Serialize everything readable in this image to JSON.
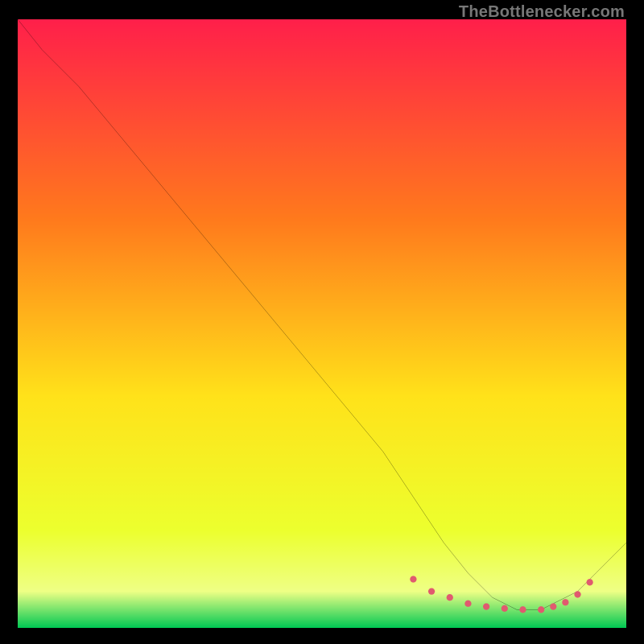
{
  "attribution": "TheBottlenecker.com",
  "chart_data": {
    "type": "line",
    "title": "",
    "xlabel": "",
    "ylabel": "",
    "xlim": [
      0,
      100
    ],
    "ylim": [
      0,
      100
    ],
    "background_gradient": {
      "top_color": "#ff1f4a",
      "upper_mid_color": "#ff7a1c",
      "mid_color": "#ffe21a",
      "lower_mid_color": "#ecff2e",
      "band_color": "#eeff85",
      "bottom_color": "#00c853"
    },
    "series": [
      {
        "name": "curve",
        "x": [
          0,
          4,
          10,
          20,
          30,
          40,
          50,
          60,
          66,
          70,
          74,
          78,
          82,
          86,
          88,
          92,
          95,
          100
        ],
        "y": [
          100,
          95,
          89,
          77,
          65,
          53,
          41,
          29,
          20,
          14,
          9,
          5,
          3,
          3,
          4,
          6,
          9,
          14
        ]
      }
    ],
    "markers": {
      "name": "highlight-band",
      "color": "#e05a6f",
      "x": [
        65,
        68,
        71,
        74,
        77,
        80,
        83,
        86,
        88,
        90,
        92,
        94
      ],
      "y": [
        8,
        6,
        5,
        4,
        3.5,
        3.2,
        3,
        3,
        3.5,
        4.2,
        5.5,
        7.5
      ]
    }
  }
}
